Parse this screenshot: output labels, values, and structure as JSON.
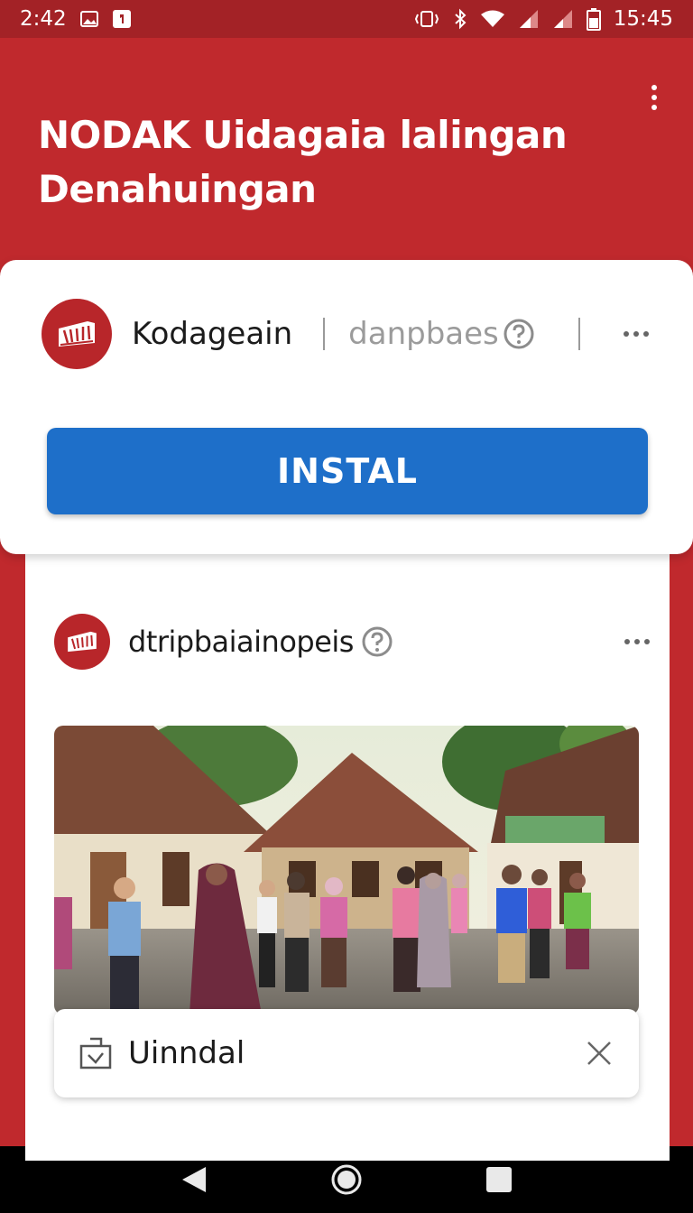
{
  "status_bar": {
    "left_time": "2:42",
    "right_time": "15:45",
    "icons": [
      "image-icon",
      "notification-icon",
      "vibrate-icon",
      "bluetooth-icon",
      "wifi-icon",
      "signal-icon",
      "signal-icon",
      "battery-icon"
    ]
  },
  "header": {
    "title": "NODAK Uidagaia lalingan Denahuingan",
    "menu_icon": "overflow-menu-icon"
  },
  "install_card": {
    "app_name": "Kodageain",
    "app_subtitle": "danpbaes",
    "install_label": "INSTAL"
  },
  "post": {
    "author": "dtripbaiainopeis",
    "photo_description_icon": "photo"
  },
  "download_bar": {
    "label": "Uinndal"
  },
  "colors": {
    "brand_red": "#c0292d",
    "status_red": "#a32226",
    "install_blue": "#1e6fc9"
  }
}
